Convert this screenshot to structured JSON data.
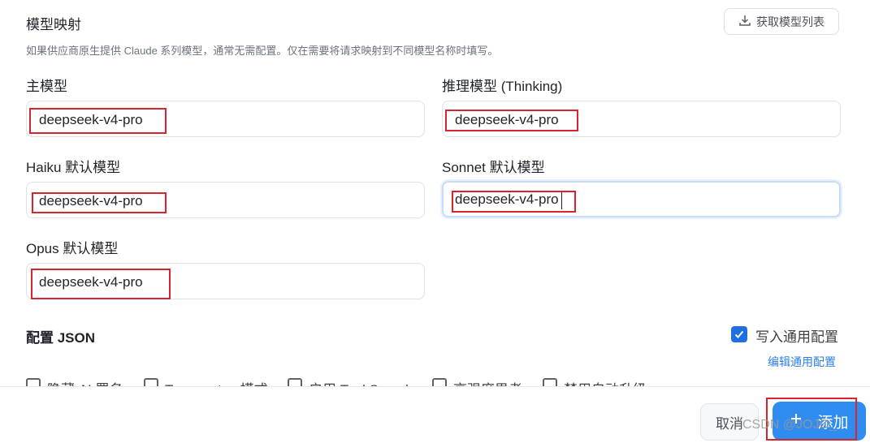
{
  "model_mapping": {
    "title": "模型映射",
    "fetch_button": "获取模型列表",
    "description": "如果供应商原生提供 Claude 系列模型，通常无需配置。仅在需要将请求映射到不同模型名称时填写。",
    "main_model": {
      "label": "主模型",
      "value": "deepseek-v4-pro"
    },
    "reasoning_model": {
      "label": "推理模型 (Thinking)",
      "value": "deepseek-v4-pro"
    },
    "haiku_model": {
      "label": "Haiku 默认模型",
      "value": "deepseek-v4-pro"
    },
    "sonnet_model": {
      "label": "Sonnet 默认模型",
      "value": "deepseek-v4-pro"
    },
    "opus_model": {
      "label": "Opus 默认模型",
      "value": "deepseek-v4-pro"
    }
  },
  "config_json": {
    "title": "配置 JSON",
    "write_common_label": "写入通用配置",
    "write_common_checked": true,
    "edit_common_link": "编辑通用配置",
    "options": [
      "隐藏 AI 署名",
      "Teammates 模式",
      "启用 Tool Search",
      "高强度思考",
      "禁用自动升级"
    ]
  },
  "footer": {
    "cancel": "取消",
    "add": "添加",
    "add_icon": "plus-icon"
  },
  "watermark": "CSDN @JOJO_",
  "colors": {
    "accent": "#2f8cf0",
    "highlight": "#d9232e",
    "link": "#2e7fe6"
  }
}
